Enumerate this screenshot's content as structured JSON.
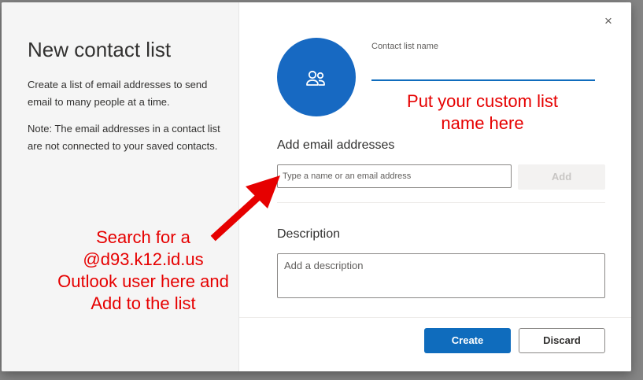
{
  "left_pane": {
    "title": "New contact list",
    "description": "Create a list of email addresses to send email to many people at a time.",
    "note": "Note: The email addresses in a contact list are not connected to your saved contacts."
  },
  "header": {
    "close_icon": "×",
    "avatar_icon": "people-icon"
  },
  "form": {
    "name_label": "Contact list name",
    "name_value": "",
    "add_heading": "Add email addresses",
    "email_placeholder": "Type a name or an email address",
    "add_button": "Add",
    "description_heading": "Description",
    "description_placeholder": "Add a description"
  },
  "footer": {
    "create_button": "Create",
    "discard_button": "Discard"
  },
  "annotations": {
    "name_hint": "Put your custom list\nname here",
    "search_hint": "Search for a\n@d93.k12.id.us\nOutlook user here and\nAdd to the list"
  },
  "colors": {
    "accent": "#0f6cbd",
    "avatar": "#1769c2",
    "annotation": "#e60000"
  }
}
